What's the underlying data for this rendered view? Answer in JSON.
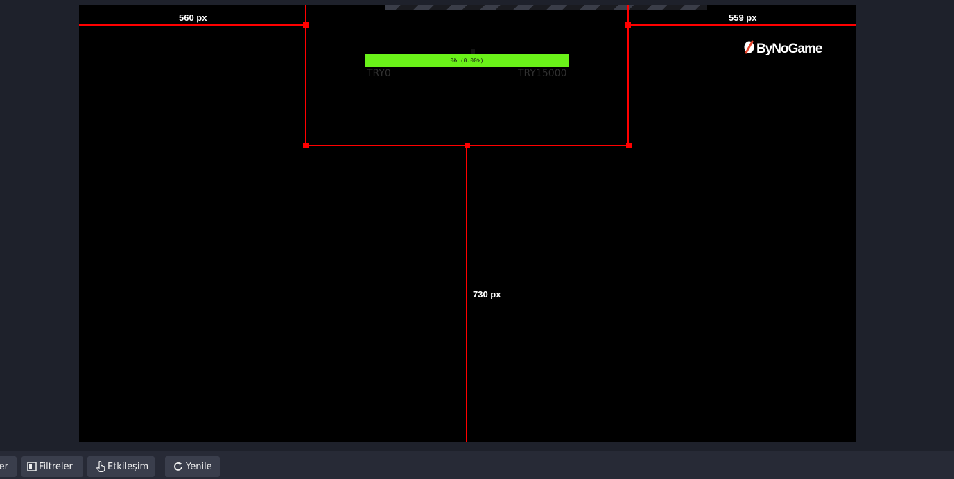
{
  "preview": {
    "left_margin_label": "560 px",
    "right_margin_label": "559 px",
    "bottom_margin_label": "730 px"
  },
  "donation_goal": {
    "bar_text": "0₺ (0.00%)",
    "progress_percent": 0,
    "min_label": "TRY0",
    "max_label": "TRY15000",
    "bar_color": "#6af219"
  },
  "logo": {
    "text": "ByNoGame",
    "icon": "bynogame-logo-icon"
  },
  "colors": {
    "selection": "#ff0000",
    "preview_bg": "#000000",
    "app_bg": "#1e212b"
  },
  "toolbar": {
    "partial_button_label": "er",
    "filters_label": "Filtreler",
    "filters_icon": "filter-icon",
    "interact_label": "Etkileşim",
    "interact_icon": "hand-pointer-icon",
    "refresh_label": "Yenile",
    "refresh_icon": "refresh-icon"
  }
}
